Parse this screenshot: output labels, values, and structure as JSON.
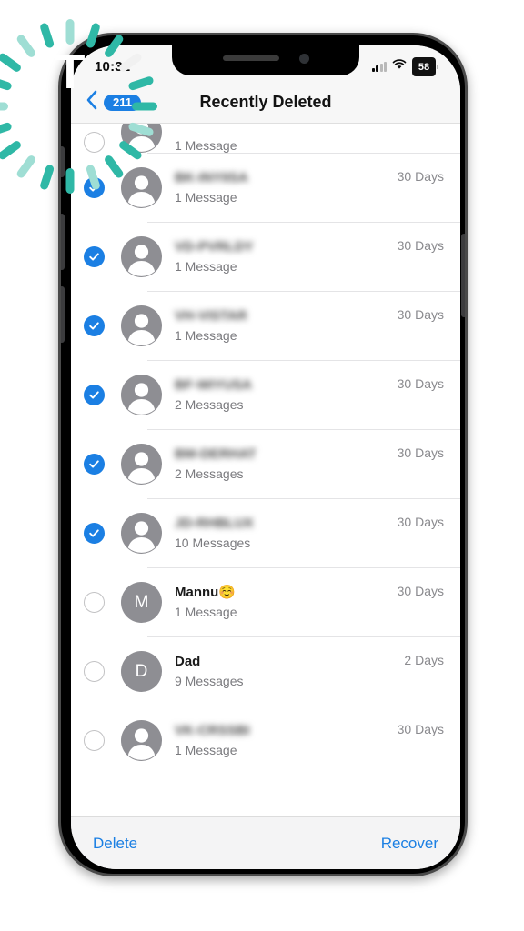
{
  "watermark": {
    "letter": "T",
    "ray_color": "#2fb8a6",
    "ray_color_light": "#9fded4"
  },
  "device": {
    "frame_color": "#000000",
    "bezel_color": "#4a4a4a",
    "buttons": [
      "silent-switch",
      "volume-up",
      "volume-down",
      "power"
    ]
  },
  "status_bar": {
    "time": "10:32",
    "cellular_icon": "signal-bars-icon",
    "wifi_icon": "wifi-icon",
    "battery_percent": "58",
    "battery_icon": "battery-icon"
  },
  "nav_bar": {
    "back_icon": "chevron-left-icon",
    "back_badge": "211",
    "title": "Recently Deleted",
    "accent_color": "#1b7fe3"
  },
  "list": {
    "rows": [
      {
        "name": "",
        "redacted": true,
        "messages": "1 Message",
        "date": "",
        "selected": false,
        "avatar_type": "person",
        "initial": "",
        "partial": true
      },
      {
        "name": "BK-INYIISA",
        "redacted": true,
        "messages": "1 Message",
        "date": "30 Days",
        "selected": true,
        "avatar_type": "person",
        "initial": "",
        "partial": false
      },
      {
        "name": "VD-PVRLDY",
        "redacted": true,
        "messages": "1 Message",
        "date": "30 Days",
        "selected": true,
        "avatar_type": "person",
        "initial": "",
        "partial": false
      },
      {
        "name": "VH-VISTAR",
        "redacted": true,
        "messages": "1 Message",
        "date": "30 Days",
        "selected": true,
        "avatar_type": "person",
        "initial": "",
        "partial": false
      },
      {
        "name": "BF-WIYUSA",
        "redacted": true,
        "messages": "2 Messages",
        "date": "30 Days",
        "selected": true,
        "avatar_type": "person",
        "initial": "",
        "partial": false
      },
      {
        "name": "BM-DERHAT",
        "redacted": true,
        "messages": "2 Messages",
        "date": "30 Days",
        "selected": true,
        "avatar_type": "person",
        "initial": "",
        "partial": false
      },
      {
        "name": "JD-RHBLUX",
        "redacted": true,
        "messages": "10 Messages",
        "date": "30 Days",
        "selected": true,
        "avatar_type": "person",
        "initial": "",
        "partial": false
      },
      {
        "name": "Mannu☺️",
        "redacted": false,
        "messages": "1 Message",
        "date": "30 Days",
        "selected": false,
        "avatar_type": "initial",
        "initial": "M",
        "partial": false
      },
      {
        "name": "Dad",
        "redacted": false,
        "messages": "9 Messages",
        "date": "2 Days",
        "selected": false,
        "avatar_type": "initial",
        "initial": "D",
        "partial": false
      },
      {
        "name": "VK-CRSSBI",
        "redacted": true,
        "messages": "1 Message",
        "date": "30 Days",
        "selected": false,
        "avatar_type": "person",
        "initial": "",
        "partial": false
      }
    ]
  },
  "toolbar": {
    "delete_label": "Delete",
    "recover_label": "Recover",
    "accent_color": "#1b7fe3"
  }
}
